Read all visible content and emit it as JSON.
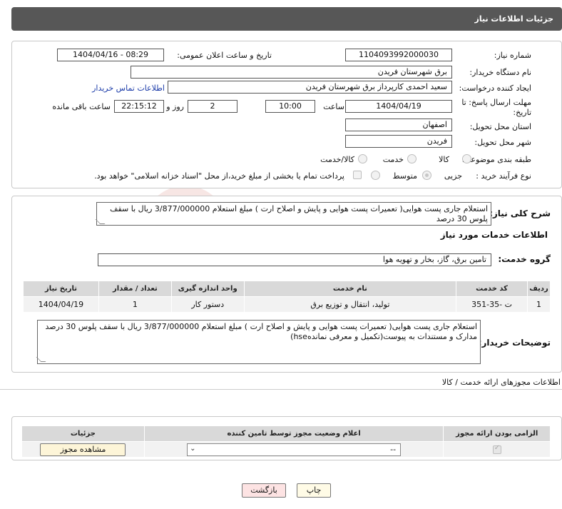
{
  "header": {
    "title": "جزئیات اطلاعات نیاز"
  },
  "form": {
    "need_number_label": "شماره نیاز:",
    "need_number": "1104093992000030",
    "announce_label": "تاریخ و ساعت اعلان عمومی:",
    "announce_value": "1404/04/16 - 08:29",
    "buyer_label": "نام دستگاه خریدار:",
    "buyer_value": "برق شهرستان فریدن",
    "creator_label": "ایجاد کننده درخواست:",
    "creator_value": "سعید احمدی کارپرداز برق شهرستان فریدن",
    "contact_link": "اطلاعات تماس خریدار",
    "deadline_label_1": "مهلت ارسال پاسخ: تا",
    "deadline_label_2": "تاریخ:",
    "deadline_date": "1404/04/19",
    "time_label": "ساعت",
    "deadline_time": "10:00",
    "days_value": "2",
    "days_label": "روز و",
    "remaining_time": "22:15:12",
    "remaining_label": "ساعت باقی مانده",
    "province_label": "استان محل تحویل:",
    "province_value": "اصفهان",
    "city_label": "شهر محل تحویل:",
    "city_value": "فریدن",
    "category_label": "طبقه بندی موضوعی:",
    "category_options": [
      "کالا",
      "خدمت",
      "کالا/خدمت"
    ],
    "process_label": "نوع فرآیند خرید :",
    "process_options": [
      "جزیی",
      "متوسط"
    ],
    "treasury_note": "پرداخت تمام یا بخشی از مبلغ خرید،از محل \"اسناد خزانه اسلامی\" خواهد بود."
  },
  "summary": {
    "label": "شرح کلی نیاز:",
    "text": "استعلام جاری پست هوایی( تعمیرات پست هوایی و پایش و اصلاح ارت ) مبلغ استعلام 3/877/000000 ریال با سقف پلوس 30 درصد",
    "services_heading": "اطلاعات خدمات مورد نیاز",
    "service_group_label": "گروه خدمت:",
    "service_group_value": "تامین برق، گاز، بخار و تهویه هوا"
  },
  "service_table": {
    "headers": [
      "ردیف",
      "کد خدمت",
      "نام خدمت",
      "واحد اندازه گیری",
      "تعداد / مقدار",
      "تاریخ نیاز"
    ],
    "rows": [
      [
        "1",
        "ت -35-351",
        "تولید، انتقال و توزیع برق",
        "دستور کار",
        "1",
        "1404/04/19"
      ]
    ]
  },
  "buyer_notes": {
    "label": "توضیحات خریدار:",
    "text": "استعلام جاری پست هوایی( تعمیرات پست هوایی و پایش و اصلاح ارت ) مبلغ استعلام 3/877/000000 ریال با سقف پلوس 30 درصد مدارک و مستندات به پیوست(تکمیل و معرفی نمانده‌hse)"
  },
  "permits": {
    "heading": "اطلاعات مجوزهای ارائه خدمت / کالا",
    "headers": [
      "الزامی بودن ارائه مجوز",
      "اعلام وضعیت مجوز توسط تامین کننده",
      "جزئیات"
    ],
    "select_value": "--",
    "view_button": "مشاهده مجوز"
  },
  "footer": {
    "print_button": "چاپ",
    "back_button": "بازگشت"
  },
  "watermark": "AriaTender.neT",
  "colors": {
    "titlebar": "#575757",
    "link": "#1a3aa8",
    "back_bg": "#fde3e3",
    "watermark": "#c0392b"
  }
}
